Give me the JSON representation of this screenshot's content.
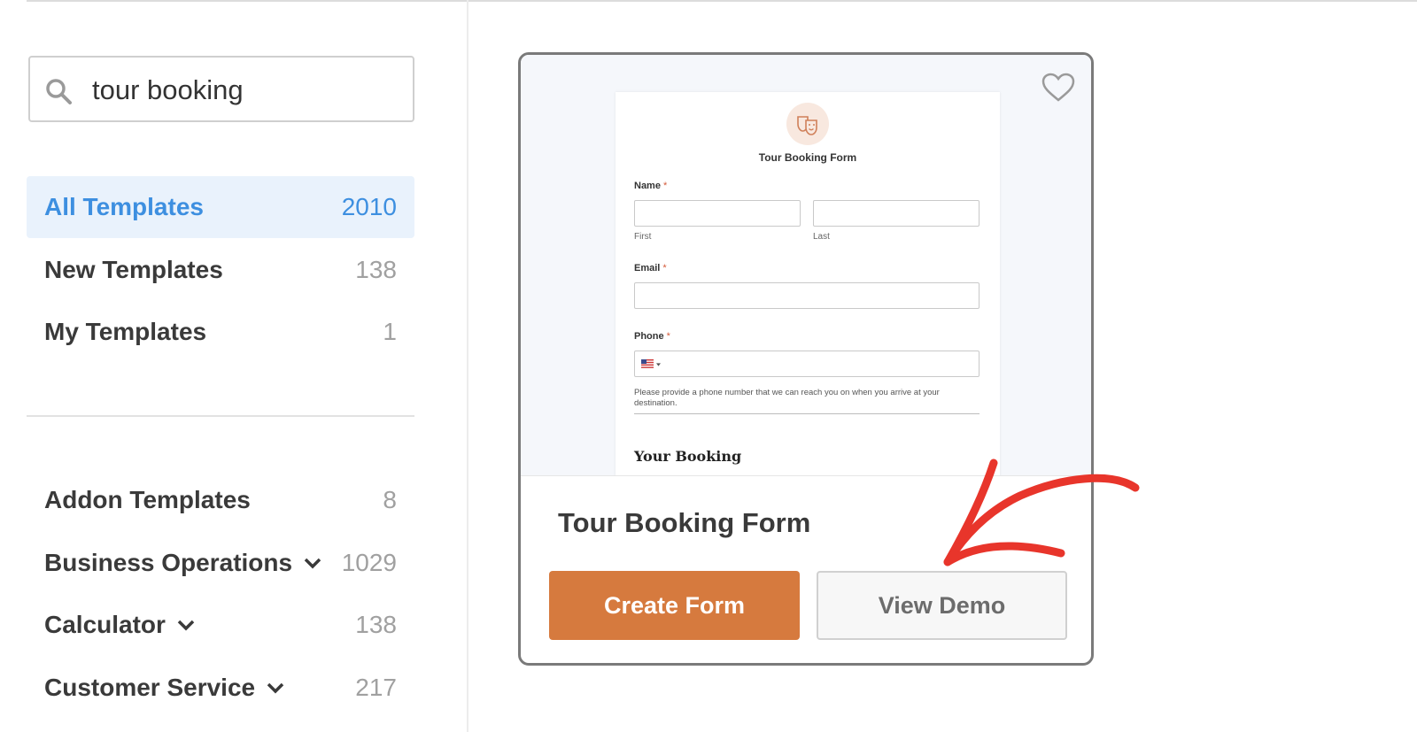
{
  "search": {
    "value": "tour booking"
  },
  "nav": {
    "primary": [
      {
        "label": "All Templates",
        "count": "2010"
      },
      {
        "label": "New Templates",
        "count": "138"
      },
      {
        "label": "My Templates",
        "count": "1"
      }
    ],
    "categories": [
      {
        "label": "Addon Templates",
        "count": "8"
      },
      {
        "label": "Business Operations",
        "count": "1029"
      },
      {
        "label": "Calculator",
        "count": "138"
      },
      {
        "label": "Customer Service",
        "count": "217"
      }
    ]
  },
  "card": {
    "title": "Tour Booking Form",
    "create_label": "Create Form",
    "demo_label": "View Demo",
    "preview": {
      "form_title": "Tour Booking Form",
      "name_label": "Name",
      "first_label": "First",
      "last_label": "Last",
      "email_label": "Email",
      "phone_label": "Phone",
      "required_mark": "*",
      "phone_help": "Please provide a phone number that we can reach you on when you arrive at your destination.",
      "section_title": "Your Booking"
    }
  },
  "colors": {
    "accent": "#3d8fe0",
    "primary_button": "#d67a3e",
    "annotation_arrow": "#e8352b"
  },
  "icons": {
    "search": "search-icon",
    "favorite": "heart-icon",
    "expand": "chevron-down-icon",
    "flag": "us-flag-icon"
  }
}
